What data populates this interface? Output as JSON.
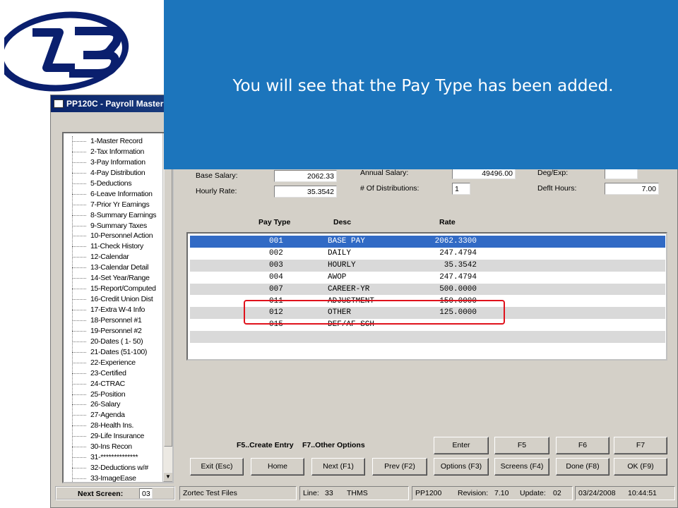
{
  "window": {
    "title": "PP120C - Payroll Master"
  },
  "callout": {
    "text": "You will see that the Pay Type has been added."
  },
  "tree": {
    "items": [
      "1-Master Record",
      "2-Tax Information",
      "3-Pay Information",
      "4-Pay Distribution",
      "5-Deductions",
      "6-Leave Information",
      "7-Prior Yr Earnings",
      "8-Summary Earnings",
      "9-Summary Taxes",
      "10-Personnel Action",
      "11-Check History",
      "12-Calendar",
      "13-Calendar Detail",
      "14-Set Year/Range",
      "15-Report/Computed",
      "16-Credit Union Dist",
      "17-Extra W-4 Info",
      "18-Personnel #1",
      "19-Personnel #2",
      "20-Dates ( 1- 50)",
      "21-Dates (51-100)",
      "22-Experience",
      "23-Certified",
      "24-CTRAC",
      "25-Position",
      "26-Salary",
      "27-Agenda",
      "28-Health Ins.",
      "29-Life Insurance",
      "30-Ins Recon",
      "31-**************",
      "32-Deductions w/#",
      "33-ImageEase"
    ]
  },
  "form": {
    "base_salary_label": "Base Salary:",
    "base_salary_value": "2062.33",
    "hourly_rate_label": "Hourly Rate:",
    "hourly_rate_value": "35.3542",
    "annual_salary_label": "Annual Salary:",
    "annual_salary_value": "49496.00",
    "num_distributions_label": "# Of Distributions:",
    "num_distributions_value": "1",
    "deg_exp_label": "Deg/Exp:",
    "deg_exp_value": "",
    "deflt_hours_label": "Deflt Hours:",
    "deflt_hours_value": "7.00"
  },
  "pay_table": {
    "headers": [
      "Pay Type",
      "Desc",
      "Rate"
    ],
    "rows": [
      {
        "code": "001",
        "desc": "BASE PAY",
        "rate": "2062.3300"
      },
      {
        "code": "002",
        "desc": "DAILY",
        "rate": "247.4794"
      },
      {
        "code": "003",
        "desc": "HOURLY",
        "rate": "35.3542"
      },
      {
        "code": "004",
        "desc": "AWOP",
        "rate": "247.4794"
      },
      {
        "code": "007",
        "desc": "CAREER-YR",
        "rate": "500.0000"
      },
      {
        "code": "011",
        "desc": "ADJUSTMENT",
        "rate": "150.0000"
      },
      {
        "code": "012",
        "desc": "OTHER",
        "rate": "125.0000"
      },
      {
        "code": "015",
        "desc": "DEF/AF SCH",
        "rate": ""
      }
    ],
    "selected_index": 0
  },
  "shortcuts": {
    "create_entry": "F5..Create Entry",
    "other_options": "F7..Other Options"
  },
  "buttons": {
    "enter": "Enter",
    "f5": "F5",
    "f6": "F6",
    "f7": "F7",
    "exit": "Exit (Esc)",
    "home": "Home",
    "next": "Next (F1)",
    "prev": "Prev (F2)",
    "options": "Options (F3)",
    "screens": "Screens (F4)",
    "done": "Done (F8)",
    "ok": "OK (F9)"
  },
  "status": {
    "next_screen_label": "Next Screen:",
    "next_screen_value": "03",
    "company": "Zortec Test Files",
    "line_label": "Line:",
    "line_value": "33",
    "user": "THMS",
    "program": "PP1200",
    "revision_label": "Revision:",
    "revision_value": "7.10",
    "update_label": "Update:",
    "update_value": "02",
    "date": "03/24/2008",
    "time": "10:44:51"
  },
  "colors": {
    "callout": "#1c75bc",
    "selection": "#316ac5",
    "highlight": "#e0121c"
  }
}
